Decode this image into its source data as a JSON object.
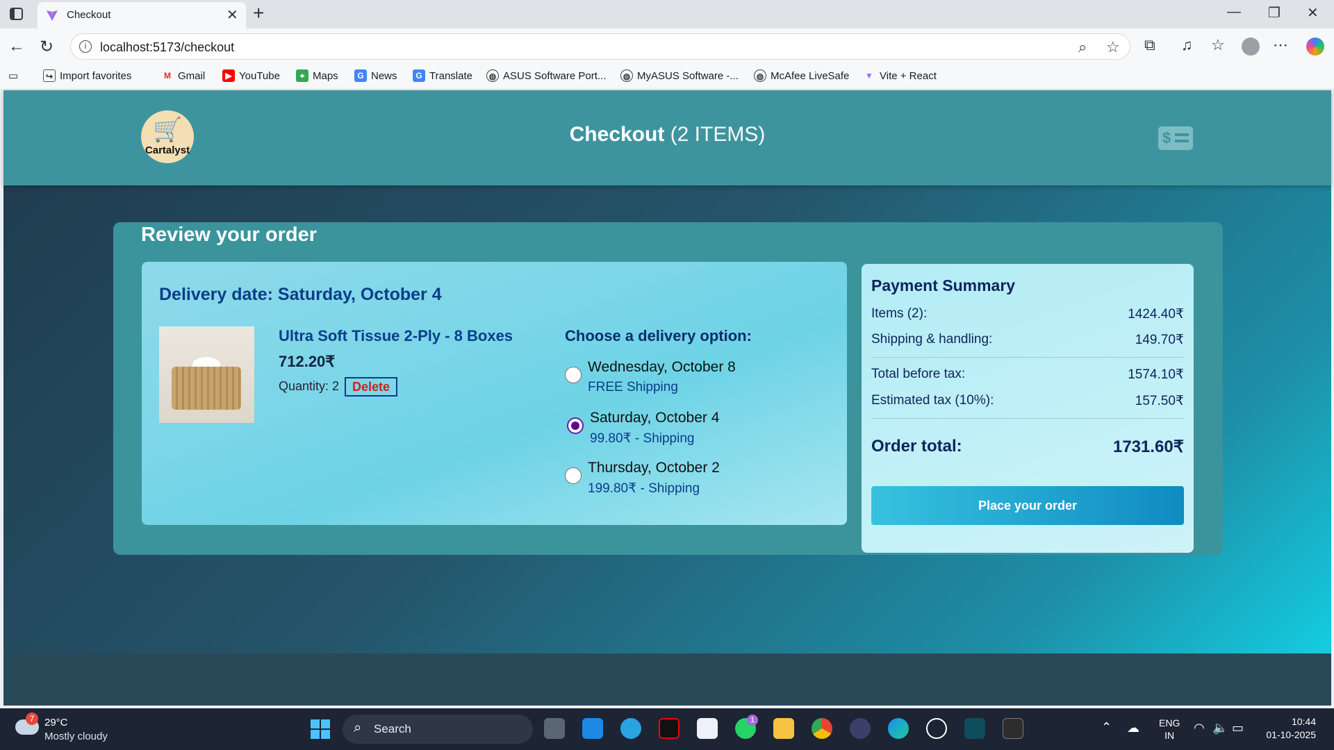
{
  "browser": {
    "tab_title": "Checkout",
    "url": "localhost:5173/checkout",
    "bookmarks": [
      "Import favorites",
      "Gmail",
      "YouTube",
      "Maps",
      "News",
      "Translate",
      "ASUS Software Port...",
      "MyASUS Software -...",
      "McAfee LiveSafe",
      "Vite + React"
    ]
  },
  "app": {
    "logo_text": "Cartalyst",
    "title_main": "Checkout",
    "title_count": "(2 ITEMS)",
    "review_title": "Review your order",
    "delivery_date": "Delivery date: Saturday, October 4",
    "product": {
      "name": "Ultra Soft Tissue 2-Ply - 8 Boxes",
      "price": "712.20₹",
      "quantity_label": "Quantity: 2",
      "delete_label": "Delete"
    },
    "delivery": {
      "title": "Choose a delivery option:",
      "options": [
        {
          "day": "Wednesday, October 8",
          "shipping": "FREE Shipping",
          "selected": false
        },
        {
          "day": "Saturday, October 4",
          "shipping": "99.80₹ - Shipping",
          "selected": true
        },
        {
          "day": "Thursday, October 2",
          "shipping": "199.80₹ - Shipping",
          "selected": false
        }
      ]
    },
    "summary": {
      "title": "Payment Summary",
      "items_label": "Items (2):",
      "items_value": "1424.40₹",
      "shipping_label": "Shipping & handling:",
      "shipping_value": "149.70₹",
      "before_tax_label": "Total before tax:",
      "before_tax_value": "1574.10₹",
      "tax_label": "Estimated tax (10%):",
      "tax_value": "157.50₹",
      "total_label": "Order total:",
      "total_value": "1731.60₹",
      "place_order": "Place your order"
    }
  },
  "taskbar": {
    "temperature": "29°C",
    "condition": "Mostly cloudy",
    "weather_badge": "7",
    "search_label": "Search",
    "whatsapp_badge": "1",
    "lang_top": "ENG",
    "lang_bottom": "IN",
    "time": "10:44",
    "date": "01-10-2025"
  },
  "colors": {
    "header": "#3e949e",
    "title_blue": "#0b3d8a",
    "delete_red": "#d0211c",
    "radio_selected": "#5a0b8e"
  }
}
